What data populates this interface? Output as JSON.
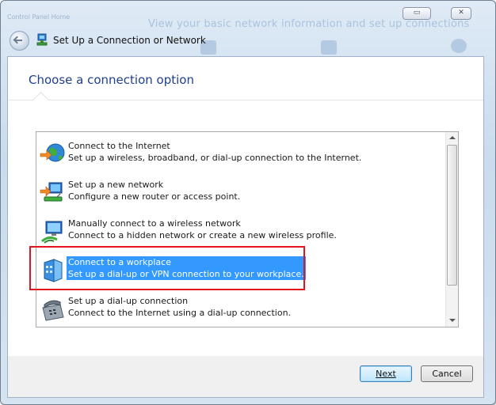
{
  "window": {
    "title": "Set Up a Connection or Network",
    "background_ghost": "View your basic network information and set up connections",
    "background_left": "Control Panel Home",
    "min_button": "▭",
    "close_button": "✕"
  },
  "page": {
    "heading": "Choose a connection option"
  },
  "options": [
    {
      "line1": "Connect to the Internet",
      "line2": "Set up a wireless, broadband, or dial-up connection to the Internet.",
      "icon": "globe-icon"
    },
    {
      "line1": "Set up a new network",
      "line2": "Configure a new router or access point.",
      "icon": "router-icon"
    },
    {
      "line1": "Manually connect to a wireless network",
      "line2": "Connect to a hidden network or create a new wireless profile.",
      "icon": "wireless-icon"
    },
    {
      "line1": "Connect to a workplace",
      "line2": "Set up a dial-up or VPN connection to your workplace.",
      "icon": "workplace-icon",
      "selected": true
    },
    {
      "line1": "Set up a dial-up connection",
      "line2": "Connect to the Internet using a dial-up connection.",
      "icon": "phone-icon"
    }
  ],
  "buttons": {
    "next": "Next",
    "cancel": "Cancel"
  },
  "colors": {
    "heading": "#1e3f8f",
    "selection": "#3399ff",
    "highlight_box": "#e0141c"
  }
}
